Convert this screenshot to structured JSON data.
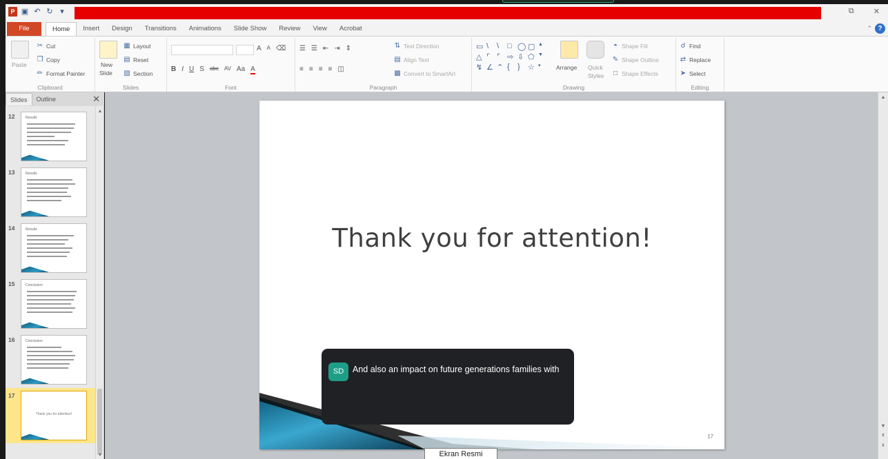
{
  "window": {
    "title": "",
    "qat_icons": [
      "save-icon",
      "undo-icon",
      "redo-icon",
      "customize-icon"
    ],
    "controls": [
      "minimize-icon",
      "close-icon"
    ]
  },
  "tabs": [
    {
      "id": "file",
      "label": "File"
    },
    {
      "id": "home",
      "label": "Home",
      "active": true
    },
    {
      "id": "insert",
      "label": "Insert"
    },
    {
      "id": "design",
      "label": "Design"
    },
    {
      "id": "transitions",
      "label": "Transitions"
    },
    {
      "id": "animations",
      "label": "Animations"
    },
    {
      "id": "slideshow",
      "label": "Slide Show"
    },
    {
      "id": "review",
      "label": "Review"
    },
    {
      "id": "view",
      "label": "View"
    },
    {
      "id": "acrobat",
      "label": "Acrobat"
    }
  ],
  "ribbon": {
    "clipboard": {
      "label": "Clipboard",
      "paste": "Paste",
      "cut": "Cut",
      "copy": "Copy",
      "format_painter": "Format Painter"
    },
    "slides": {
      "label": "Slides",
      "new_slide": "New",
      "new_slide2": "Slide",
      "layout": "Layout",
      "reset": "Reset",
      "section": "Section"
    },
    "font": {
      "label": "Font",
      "bold": "B",
      "italic": "I",
      "underline": "U",
      "shadow": "S",
      "strike": "abc",
      "spacing": "AV",
      "case": "Aa",
      "color": "A",
      "grow": "A",
      "shrink": "A"
    },
    "paragraph": {
      "label": "Paragraph",
      "text_direction": "Text Direction",
      "align_text": "Align Text",
      "convert_smartart": "Convert to SmartArt"
    },
    "drawing": {
      "label": "Drawing",
      "arrange": "Arrange",
      "quick_styles": "Quick",
      "quick_styles2": "Styles",
      "shape_fill": "Shape Fill",
      "shape_outline": "Shape Outline",
      "shape_effects": "Shape Effects"
    },
    "editing": {
      "label": "Editing",
      "find": "Find",
      "replace": "Replace",
      "select": "Select"
    }
  },
  "panel": {
    "tabs": [
      {
        "label": "Slides",
        "active": true
      },
      {
        "label": "Outline"
      }
    ],
    "thumbnails": [
      {
        "num": "12",
        "title": "Results",
        "lines": [
          70,
          68,
          64,
          40,
          60,
          55
        ]
      },
      {
        "num": "13",
        "title": "Results",
        "lines": [
          66,
          70,
          60,
          58,
          64,
          50
        ]
      },
      {
        "num": "14",
        "title": "Results",
        "lines": [
          68,
          60,
          55,
          66,
          62,
          58
        ]
      },
      {
        "num": "15",
        "title": "Conclusion",
        "lines": [
          72,
          70,
          68,
          64,
          70,
          66
        ]
      },
      {
        "num": "16",
        "title": "Conclusion",
        "lines": [
          50,
          66,
          70,
          68,
          62,
          60
        ]
      },
      {
        "num": "17",
        "title": "",
        "center": "Thank you for attention!",
        "selected": true
      }
    ]
  },
  "slide": {
    "title": "Thank you for attention!",
    "number": "17"
  },
  "caption": {
    "initials": "SD",
    "text": "And also an impact on future generations families with",
    "avatar_color": "#1f9e87"
  },
  "tooltip": {
    "label": "Ekran Resmi"
  },
  "colors": {
    "accent_red": "#e60000",
    "file_tab": "#d24726",
    "selected_thumb": "#fde58c"
  }
}
